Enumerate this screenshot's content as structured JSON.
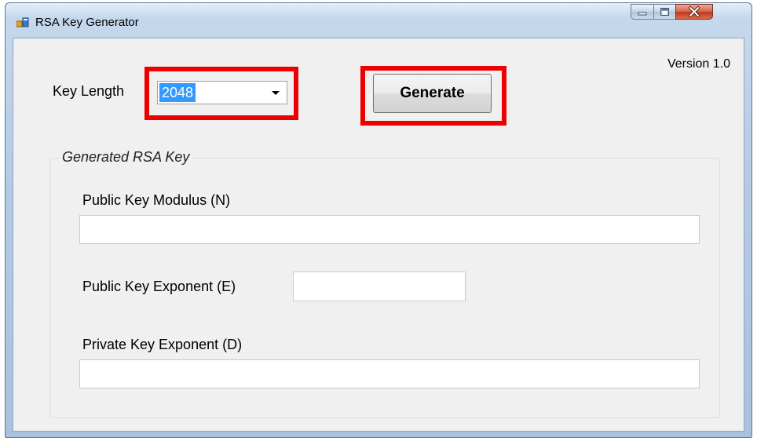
{
  "window": {
    "title": "RSA Key Generator",
    "controls": {
      "minimize": "minimize",
      "maximize": "maximize",
      "close": "X"
    }
  },
  "version": "Version 1.0",
  "key_length": {
    "label": "Key Length",
    "selected": "2048"
  },
  "generate_button": "Generate",
  "group": {
    "title": "Generated RSA Key",
    "modulus_label": "Public Key Modulus (N)",
    "modulus_value": "",
    "public_exponent_label": "Public Key Exponent (E)",
    "public_exponent_value": "",
    "private_exponent_label": "Private Key Exponent (D)",
    "private_exponent_value": ""
  },
  "colors": {
    "highlight": "#ee0000",
    "selection": "#3399ff"
  }
}
